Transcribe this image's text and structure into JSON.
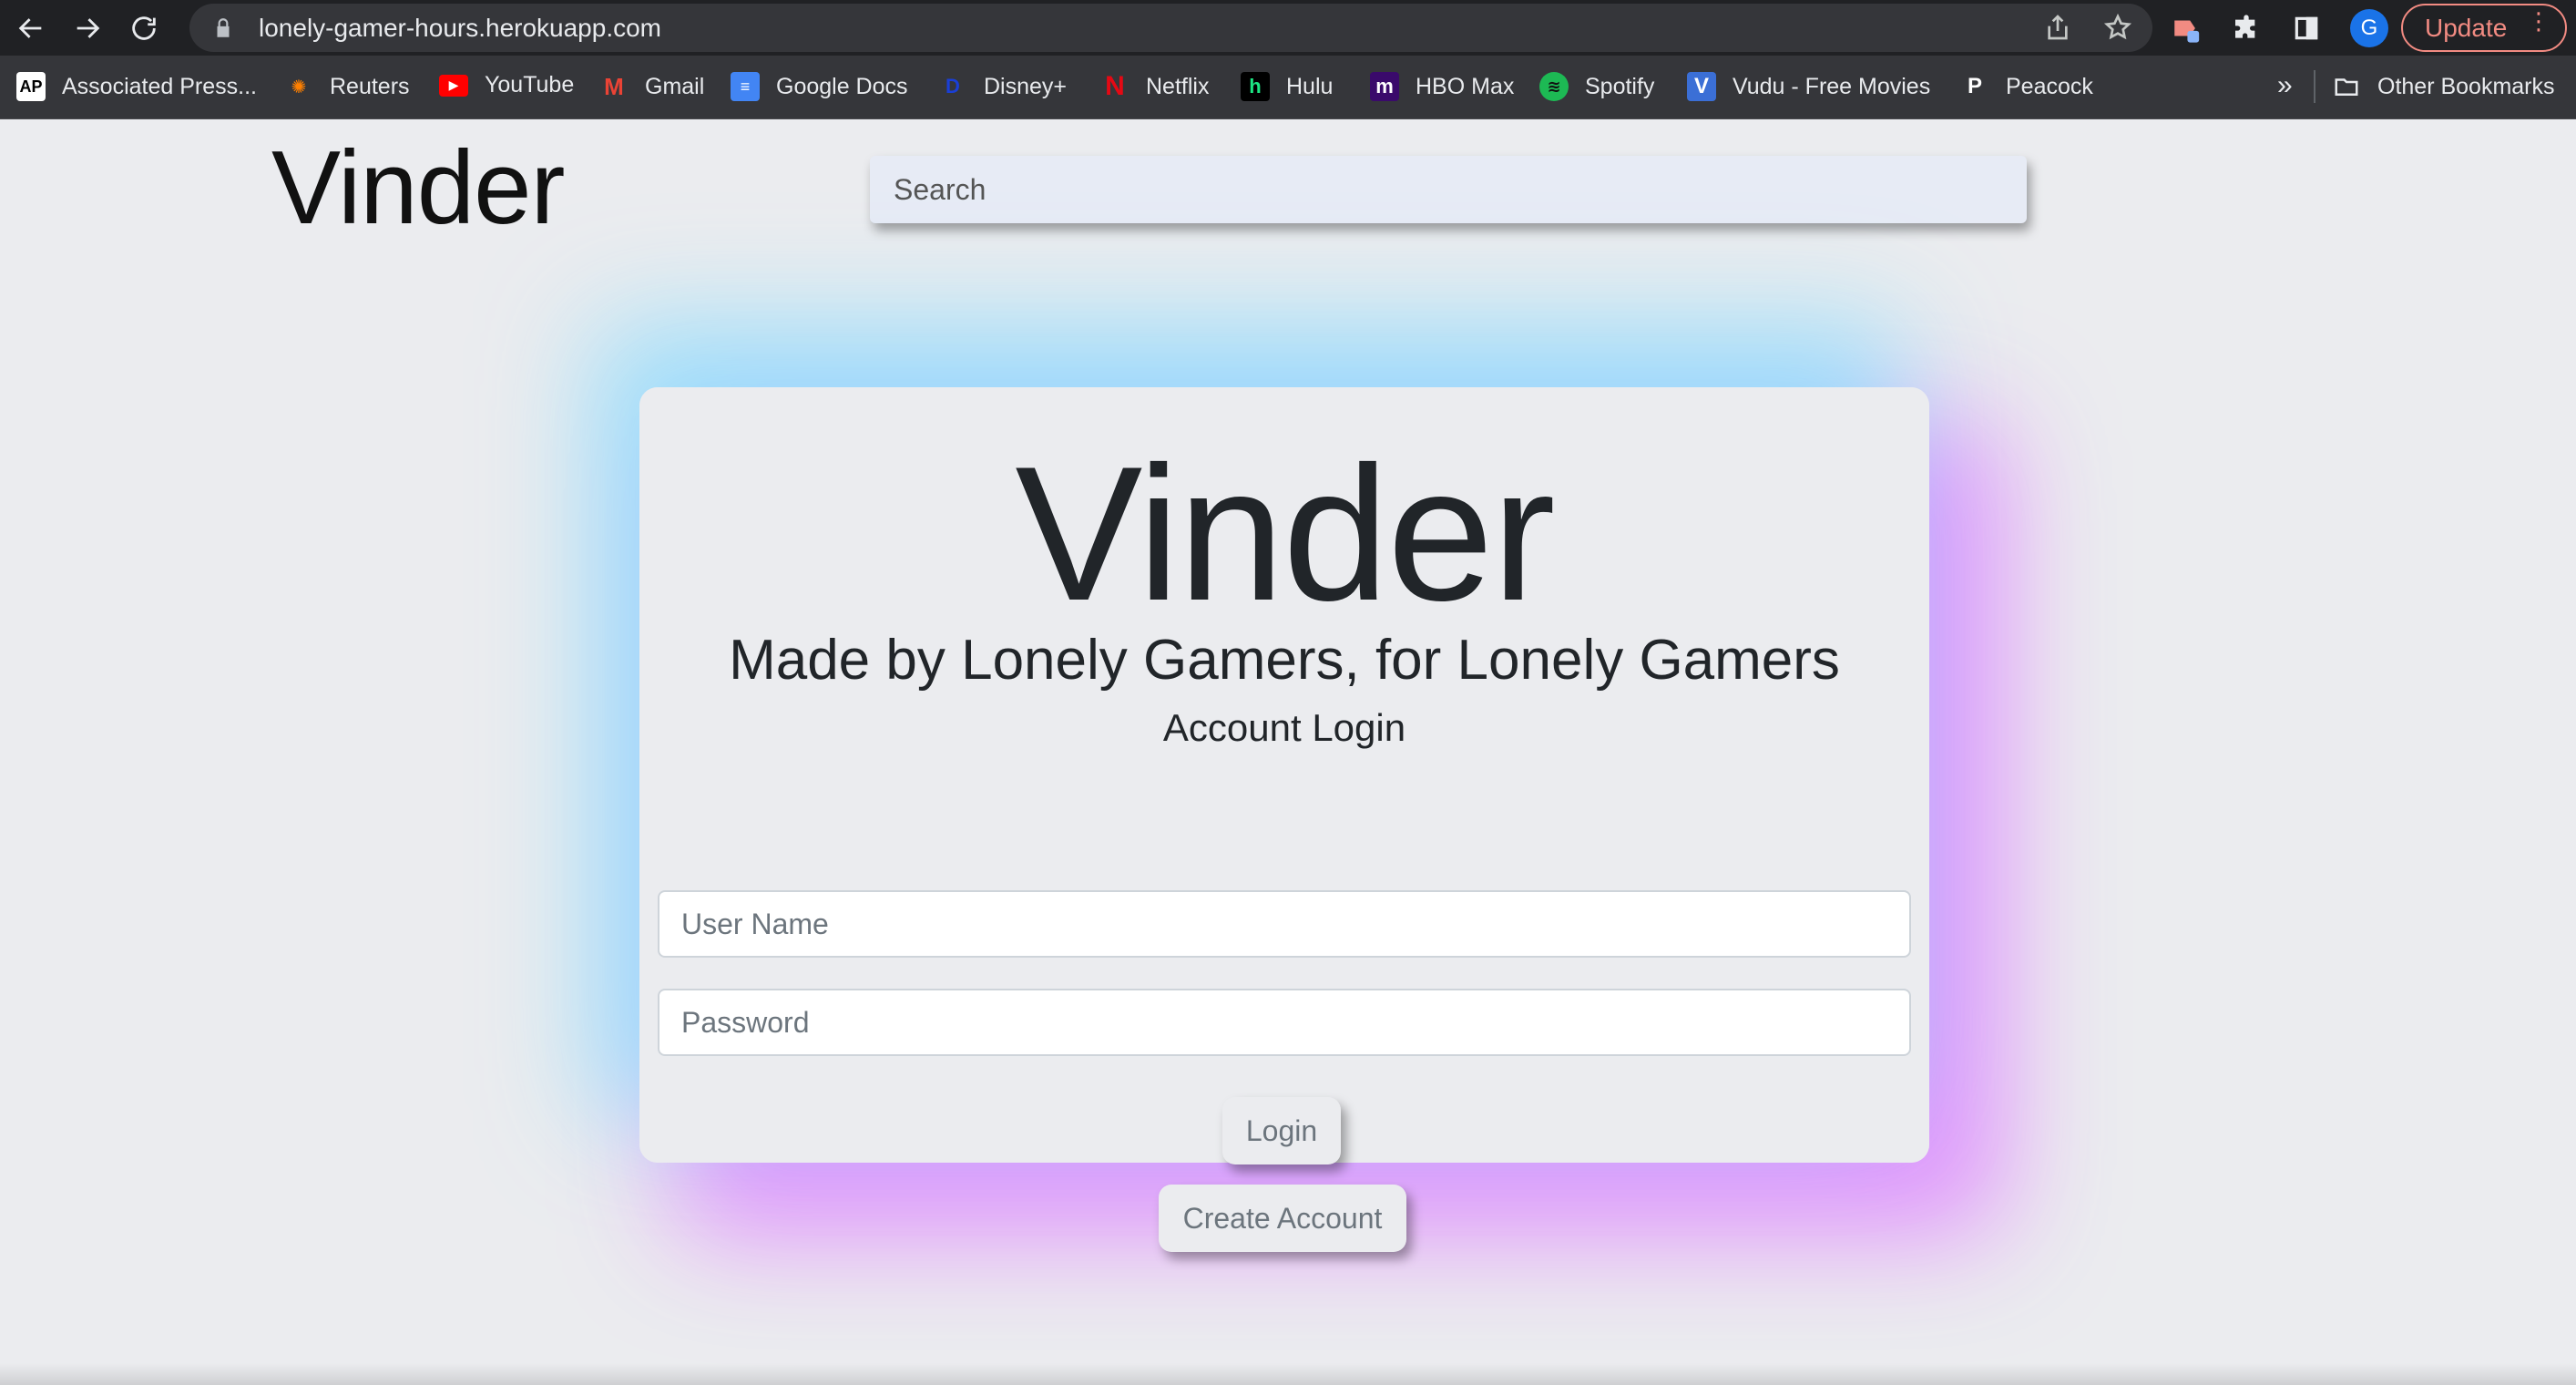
{
  "browser": {
    "url": "lonely-gamer-hours.herokuapp.com",
    "avatar_letter": "G",
    "update_label": "Update",
    "more_bookmarks": "»",
    "bookmarks": [
      {
        "label": "Associated Press...",
        "icon": "AP"
      },
      {
        "label": "Reuters",
        "icon": "reuters-icon"
      },
      {
        "label": "YouTube",
        "icon": "youtube-icon"
      },
      {
        "label": "Gmail",
        "icon": "gmail-icon"
      },
      {
        "label": "Google Docs",
        "icon": "docs-icon"
      },
      {
        "label": "Disney+",
        "icon": "disney-icon"
      },
      {
        "label": "Netflix",
        "icon": "netflix-icon"
      },
      {
        "label": "Hulu",
        "icon": "h"
      },
      {
        "label": "HBO Max",
        "icon": "m"
      },
      {
        "label": "Spotify",
        "icon": "spotify-icon"
      },
      {
        "label": "Vudu - Free Movies",
        "icon": "V"
      },
      {
        "label": "Peacock",
        "icon": "P"
      }
    ],
    "other_bookmarks": "Other Bookmarks"
  },
  "header": {
    "brand": "Vinder",
    "search_placeholder": "Search"
  },
  "login_card": {
    "title": "Vinder",
    "subtitle": "Made by Lonely Gamers, for Lonely Gamers",
    "section_label": "Account Login",
    "username_placeholder": "User Name",
    "password_placeholder": "Password",
    "login_label": "Login",
    "create_label": "Create Account"
  },
  "colors": {
    "glow_cyan": "#82dcff",
    "glow_purple": "#e182ff",
    "chrome_dark": "#202124"
  }
}
